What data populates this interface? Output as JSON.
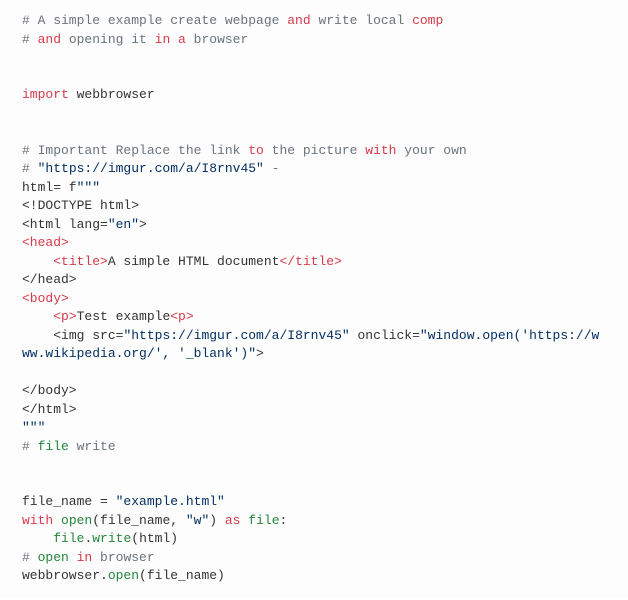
{
  "code": {
    "t01a": "# A simple example create webpage ",
    "t01b": "and",
    "t01c": " write",
    "t01d": " local ",
    "t01e": "comp",
    "t02a": "# ",
    "t02b": "and",
    "t02c": " opening it ",
    "t02d": "in",
    "t02e": " a",
    "t02f": " browser",
    "t03a": "import",
    "t03b": " webbrowser",
    "t04": "# Important Replace the link ",
    "t04b": "to",
    "t04c": " the picture ",
    "t04d": "with",
    "t04e": " your own",
    "t05a": "# ",
    "t05b": "\"https://imgur.com/a/I8rnv45\"",
    "t05c": " -",
    "t06a": "html= f",
    "t06b": "\"\"\"",
    "t07": "<!DOCTYPE html>",
    "t08a": "<html lang=",
    "t08b": "\"en\"",
    "t08c": ">",
    "t09": "<head>",
    "t10a": "    ",
    "t10b": "<title>",
    "t10c": "A simple HTML document",
    "t10d": "</title>",
    "t11": "</head>",
    "t12": "<body>",
    "t13a": "    ",
    "t13b": "<p>",
    "t13c": "Test example",
    "t13d": "<p>",
    "t14a": "    <img src=",
    "t14b": "\"https://imgur.com/a/I8rnv45\"",
    "t14c": " onclick=",
    "t14d": "\"window.open('https://www.wikipedia.org/', '_blank')\"",
    "t14e": ">",
    "t15": "</body>",
    "t16": "</html>",
    "t17": "\"\"\"",
    "t18a": "# ",
    "t18b": "file",
    "t18c": " write",
    "t19a": "file_name = ",
    "t19b": "\"example.html\"",
    "t20a": "with",
    "t20b": " open",
    "t20c": "(file_name, ",
    "t20d": "\"w\"",
    "t20e": ") ",
    "t20f": "as",
    "t20g": " file",
    "t20h": ":",
    "t21a": "    ",
    "t21b": "file",
    "t21c": ".",
    "t21d": "write",
    "t21e": "(html)",
    "t22a": "# ",
    "t22b": "open",
    "t22c": " in",
    "t22d": " browser",
    "t23a": "webbrowser.",
    "t23b": "open",
    "t23c": "(file_name)"
  }
}
